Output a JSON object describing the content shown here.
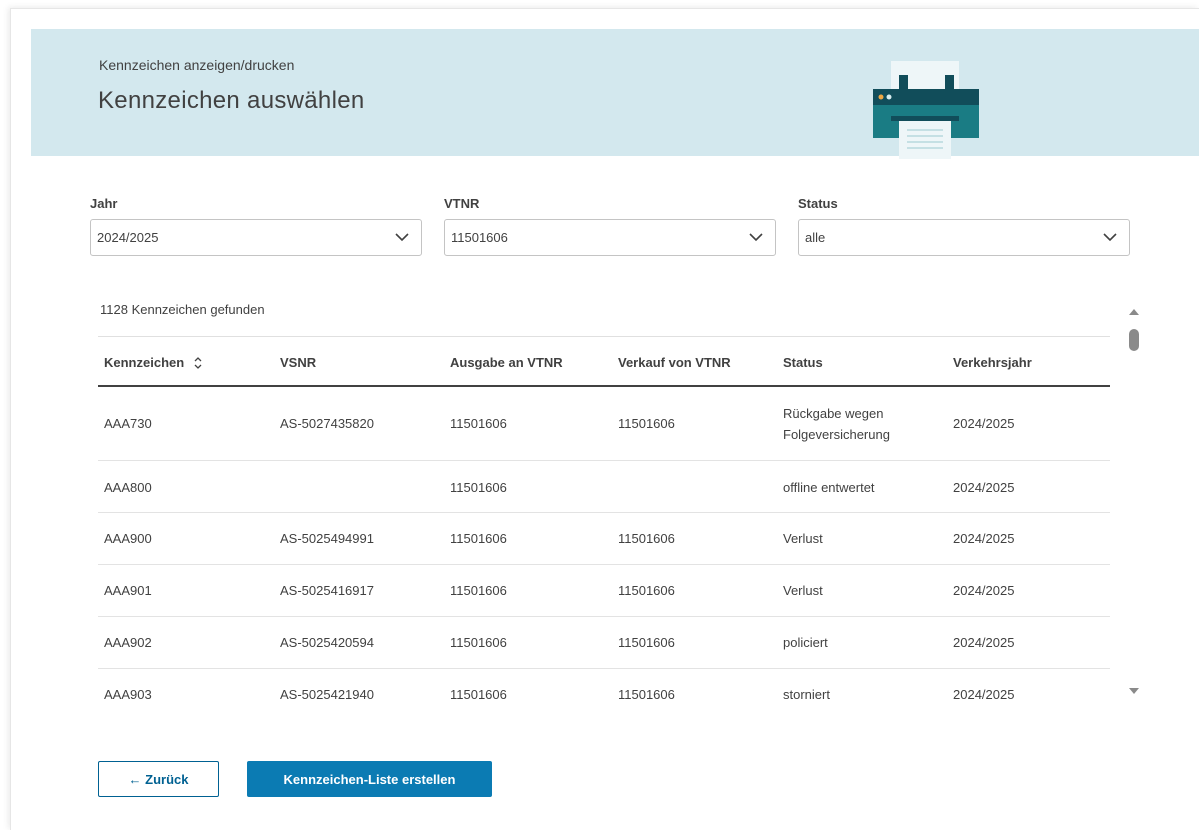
{
  "header": {
    "breadcrumb": "Kennzeichen anzeigen/drucken",
    "title": "Kennzeichen auswählen",
    "illustration": "printer-icon"
  },
  "filters": {
    "jahr": {
      "label": "Jahr",
      "value": "2024/2025"
    },
    "vtnr": {
      "label": "VTNR",
      "value": "11501606"
    },
    "status": {
      "label": "Status",
      "value": "alle"
    }
  },
  "result_count": "1128 Kennzeichen gefunden",
  "table": {
    "columns": [
      "Kennzeichen",
      "VSNR",
      "Ausgabe an VTNR",
      "Verkauf von VTNR",
      "Status",
      "Verkehrsjahr"
    ],
    "rows": [
      {
        "kennzeichen": "AAA730",
        "vsnr": "AS-5027435820",
        "ausgabe": "11501606",
        "verkauf": "11501606",
        "status_line1": "Rückgabe wegen",
        "status_line2": "Folgeversicherung",
        "jahr": "2024/2025"
      },
      {
        "kennzeichen": "AAA800",
        "vsnr": "",
        "ausgabe": "11501606",
        "verkauf": "",
        "status": "offline entwertet",
        "jahr": "2024/2025"
      },
      {
        "kennzeichen": "AAA900",
        "vsnr": "AS-5025494991",
        "ausgabe": "11501606",
        "verkauf": "11501606",
        "status": "Verlust",
        "jahr": "2024/2025"
      },
      {
        "kennzeichen": "AAA901",
        "vsnr": "AS-5025416917",
        "ausgabe": "11501606",
        "verkauf": "11501606",
        "status": "Verlust",
        "jahr": "2024/2025"
      },
      {
        "kennzeichen": "AAA902",
        "vsnr": "AS-5025420594",
        "ausgabe": "11501606",
        "verkauf": "11501606",
        "status": "policiert",
        "jahr": "2024/2025"
      },
      {
        "kennzeichen": "AAA903",
        "vsnr": "AS-5025421940",
        "ausgabe": "11501606",
        "verkauf": "11501606",
        "status": "storniert",
        "jahr": "2024/2025"
      }
    ]
  },
  "buttons": {
    "back": "← Zurück",
    "create": "Kennzeichen-Liste erstellen"
  },
  "colors": {
    "banner_bg": "#d3e8ee",
    "primary": "#0b7bb3",
    "printer_teal": "#1a7c84",
    "printer_dark": "#114d5a"
  }
}
